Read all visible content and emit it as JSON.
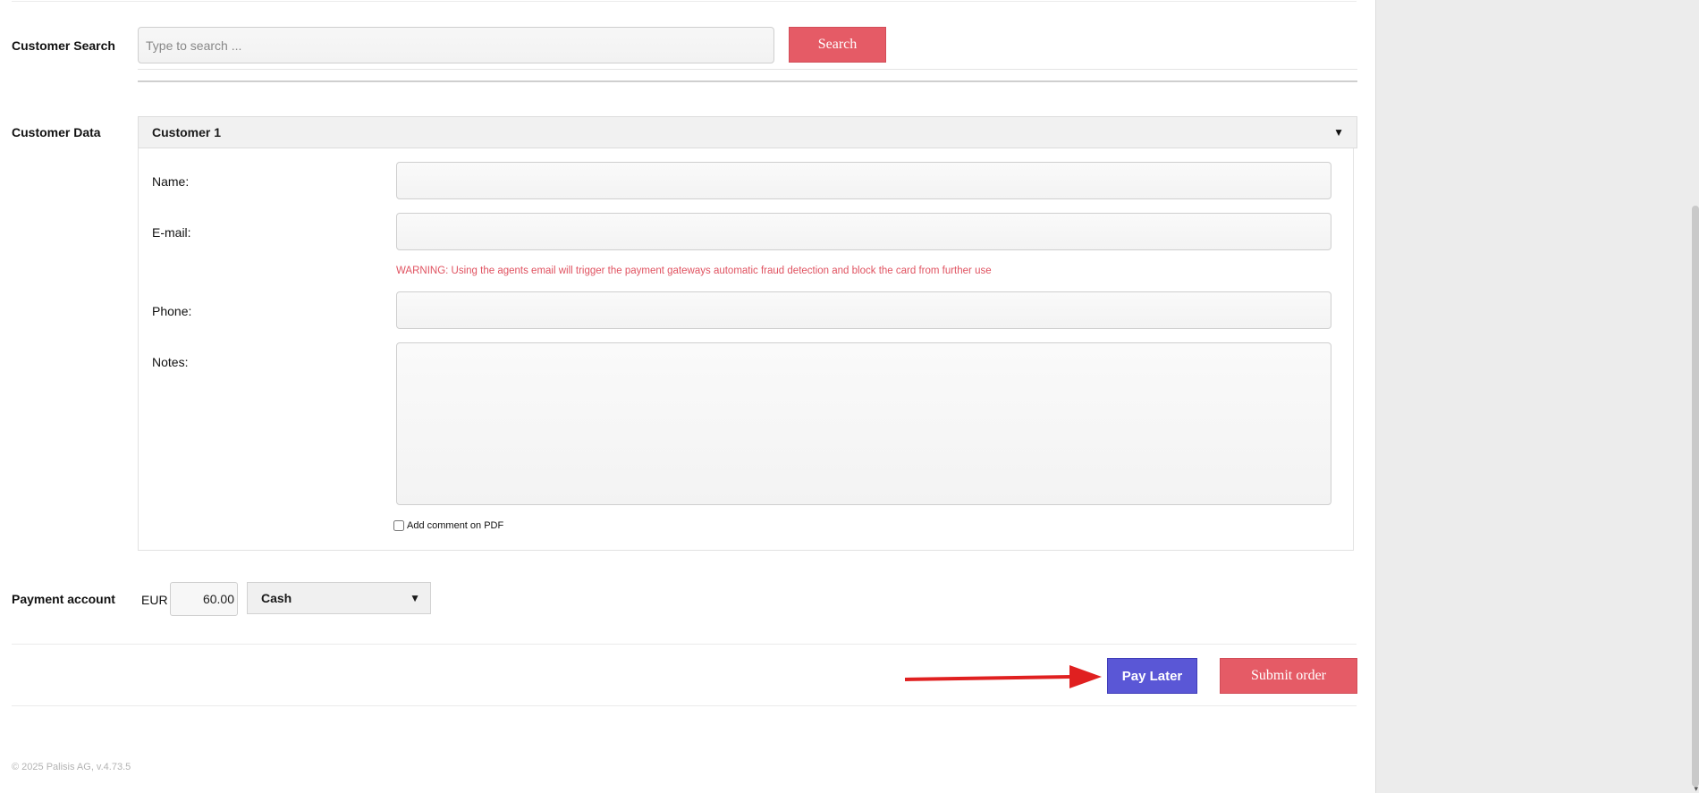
{
  "customer_search": {
    "label": "Customer Search",
    "placeholder": "Type to search ...",
    "button_label": "Search"
  },
  "customer_data": {
    "label": "Customer Data",
    "accordion_title": "Customer 1",
    "caret": "▼",
    "fields": {
      "name_label": "Name:",
      "name_value": "",
      "email_label": "E-mail:",
      "email_value": "",
      "warning": "WARNING: Using the agents email will trigger the payment gateways automatic fraud detection and block the card from further use",
      "phone_label": "Phone:",
      "phone_value": "",
      "notes_label": "Notes:",
      "notes_value": ""
    },
    "add_comment_label": "Add comment on PDF",
    "add_comment_checked": false
  },
  "payment": {
    "label": "Payment account",
    "currency": "EUR",
    "amount": "60.00",
    "method": "Cash",
    "caret": "▼"
  },
  "actions": {
    "pay_later_label": "Pay Later",
    "submit_label": "Submit order",
    "annotation_arrow_color": "#e02020"
  },
  "footer": {
    "copyright": "© 2025 Palisis AG, v.4.73.5"
  },
  "colors": {
    "accent_red": "#e55b66",
    "pay_later_blue": "#5a57d6",
    "warning_red": "#e05260"
  }
}
